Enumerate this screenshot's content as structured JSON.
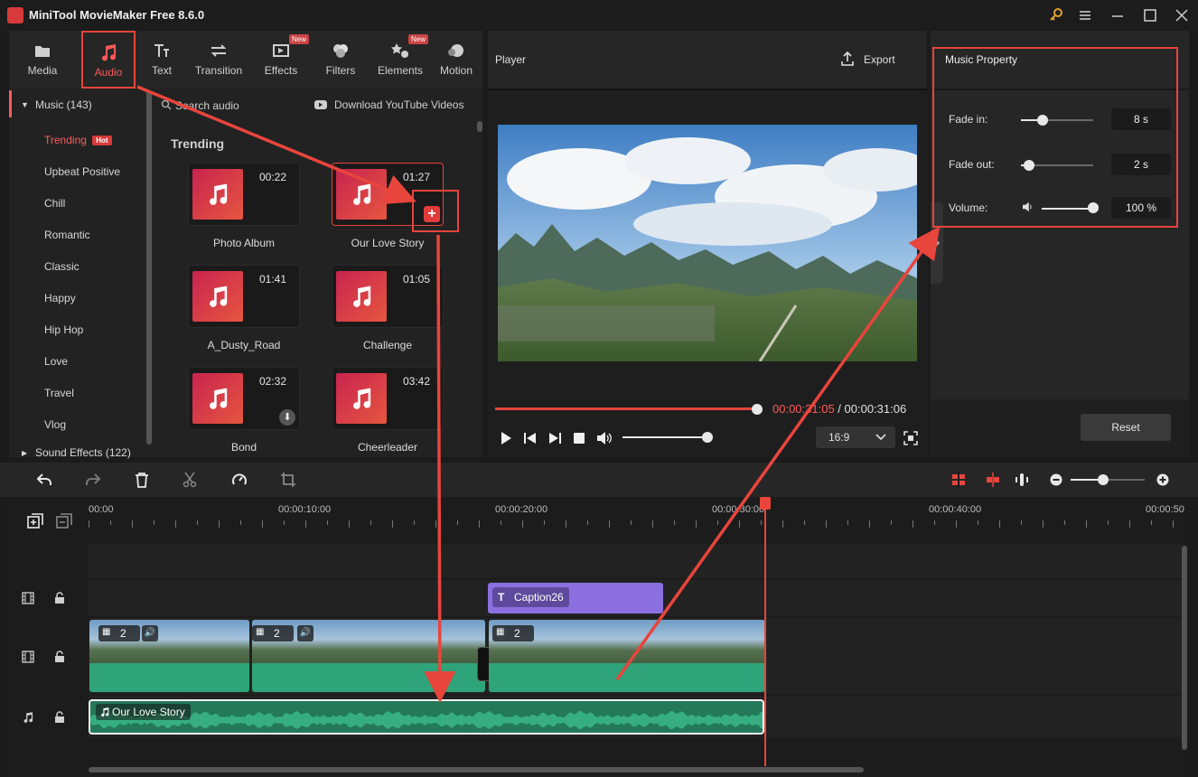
{
  "app": {
    "title": "MiniTool MovieMaker Free 8.6.0"
  },
  "toolbar": {
    "tabs": [
      {
        "label": "Media"
      },
      {
        "label": "Audio"
      },
      {
        "label": "Text"
      },
      {
        "label": "Transition"
      },
      {
        "label": "Effects",
        "badge": "New"
      },
      {
        "label": "Filters"
      },
      {
        "label": "Elements",
        "badge": "New"
      },
      {
        "label": "Motion"
      }
    ]
  },
  "library": {
    "category_header": "Music (143)",
    "categories": [
      "Trending",
      "Upbeat Positive",
      "Chill",
      "Romantic",
      "Classic",
      "Happy",
      "Hip Hop",
      "Love",
      "Travel",
      "Vlog"
    ],
    "hot_badge": "Hot",
    "sound_effects": "Sound Effects (122)",
    "search_placeholder": "Search audio",
    "download_link": "Download YouTube Videos",
    "section_title": "Trending",
    "tracks": [
      {
        "name": "Photo Album",
        "duration": "00:22"
      },
      {
        "name": "Our Love Story",
        "duration": "01:27"
      },
      {
        "name": "A_Dusty_Road",
        "duration": "01:41"
      },
      {
        "name": "Challenge",
        "duration": "01:05"
      },
      {
        "name": "Bond",
        "duration": "02:32"
      },
      {
        "name": "Cheerleader",
        "duration": "03:42"
      }
    ]
  },
  "player": {
    "title": "Player",
    "export_label": "Export",
    "current_time": "00:00:31:05",
    "separator": " / ",
    "total_time": "00:00:31:06",
    "aspect": "16:9",
    "progress": 1.0,
    "volume": 1.0
  },
  "music_property": {
    "title": "Music Property",
    "fade_in_label": "Fade in:",
    "fade_in_value": "8 s",
    "fade_out_label": "Fade out:",
    "fade_out_value": "2 s",
    "volume_label": "Volume:",
    "volume_value": "100 %",
    "reset_label": "Reset"
  },
  "timeline": {
    "ruler": [
      "00:00",
      "00:00:10:00",
      "00:00:20:00",
      "00:00:30:00",
      "00:00:40:00",
      "00:00:50"
    ],
    "caption_clip": "Caption26",
    "video_clip_counts": [
      "2",
      "2",
      "2"
    ],
    "audio_clip": "Our Love Story"
  },
  "colors": {
    "accent": "#ff5a5a",
    "annotation": "#e8453c",
    "audio_wave": "#2fa37a",
    "caption": "#8b6fe0"
  }
}
